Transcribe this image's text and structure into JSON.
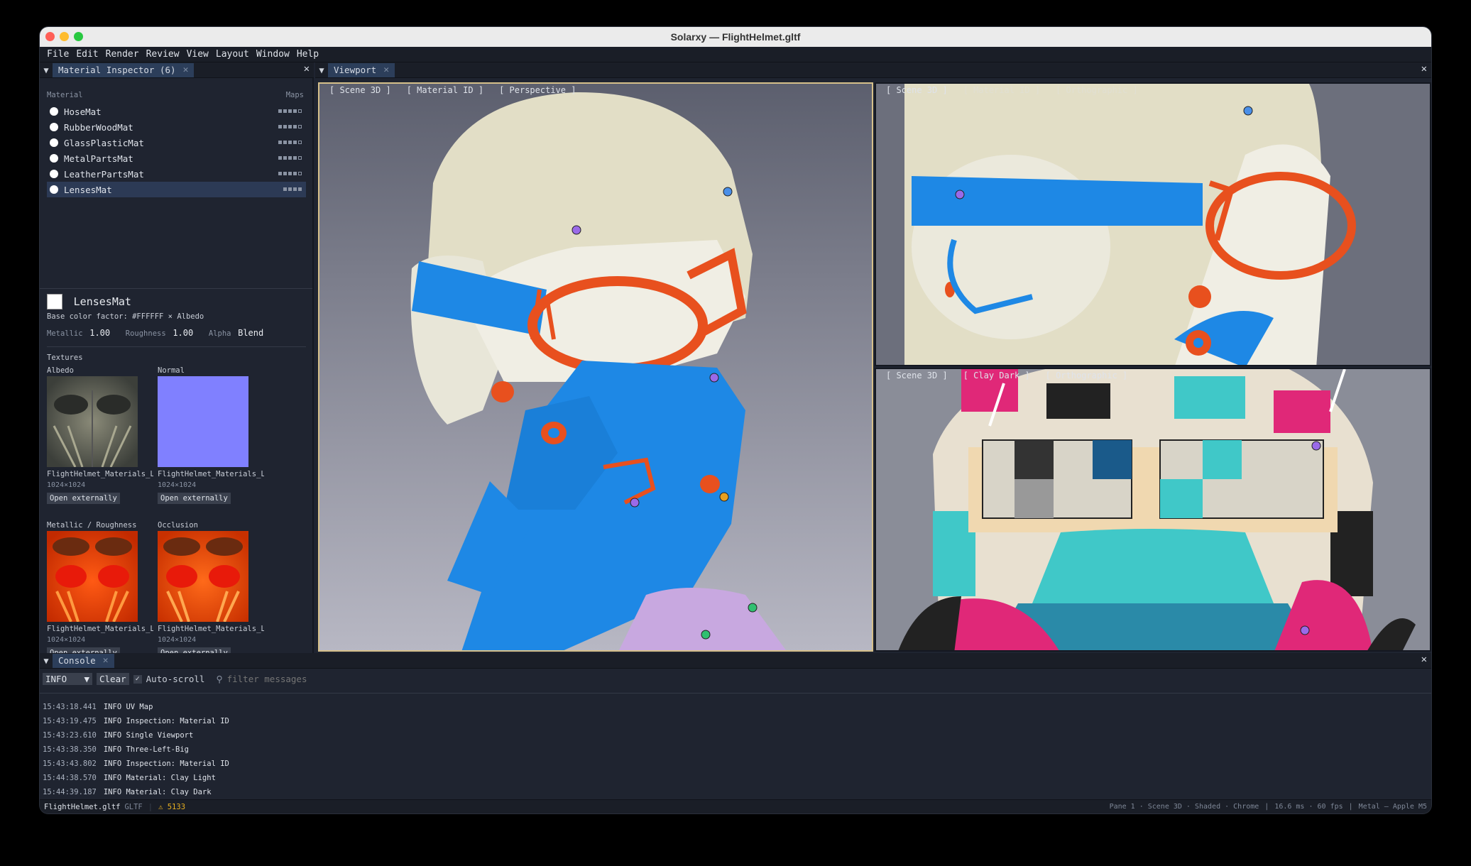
{
  "window": {
    "title": "Solarxy — FlightHelmet.gltf"
  },
  "menu": [
    "File",
    "Edit",
    "Render",
    "Review",
    "View",
    "Layout",
    "Window",
    "Help"
  ],
  "left_tab": {
    "label": "Material Inspector (6)",
    "close": "✕"
  },
  "viewport_tab": {
    "label": "Viewport",
    "close": "✕"
  },
  "console_tab": {
    "label": "Console",
    "close": "✕"
  },
  "material_list": {
    "col_material": "Material",
    "col_maps": "Maps",
    "items": [
      {
        "name": "HoseMat",
        "maps": [
          1,
          1,
          1,
          1,
          0
        ]
      },
      {
        "name": "RubberWoodMat",
        "maps": [
          1,
          1,
          1,
          1,
          0
        ]
      },
      {
        "name": "GlassPlasticMat",
        "maps": [
          1,
          1,
          1,
          1,
          0
        ]
      },
      {
        "name": "MetalPartsMat",
        "maps": [
          1,
          1,
          1,
          1,
          0
        ]
      },
      {
        "name": "LeatherPartsMat",
        "maps": [
          1,
          1,
          1,
          1,
          0
        ]
      },
      {
        "name": "LensesMat",
        "maps": [
          1,
          1,
          1,
          1
        ]
      }
    ],
    "selected": "LensesMat"
  },
  "detail": {
    "name": "LensesMat",
    "base_color": "Base color factor: #FFFFFF × Albedo",
    "metallic_label": "Metallic",
    "metallic": "1.00",
    "roughness_label": "Roughness",
    "roughness": "1.00",
    "alpha_label": "Alpha",
    "alpha": "Blend",
    "textures_label": "Textures",
    "textures": [
      {
        "slot": "Albedo",
        "file": "FlightHelmet_Materials_L…",
        "res": "1024×1024",
        "button": "Open externally"
      },
      {
        "slot": "Normal",
        "file": "FlightHelmet_Materials_L…",
        "res": "1024×1024",
        "button": "Open externally"
      },
      {
        "slot": "Metallic / Roughness",
        "file": "FlightHelmet_Materials_L…",
        "res": "1024×1024",
        "button": "Open externally"
      },
      {
        "slot": "Occlusion",
        "file": "FlightHelmet_Materials_L…",
        "res": "1024×1024",
        "button": "Open externally"
      }
    ]
  },
  "viewports": [
    {
      "labels": [
        "[ Scene 3D ]",
        "[ Material ID ]",
        "[ Perspective ]"
      ]
    },
    {
      "labels": [
        "[ Scene 3D ]",
        "[ Material ID ]",
        "[ Orthographic ]"
      ]
    },
    {
      "labels": [
        "[ Scene 3D ]",
        "[ Clay Dark ]",
        "[ Orthographic ]"
      ]
    }
  ],
  "console": {
    "level": "INFO",
    "clear": "Clear",
    "autoscroll": "Auto-scroll",
    "filter_placeholder": "filter messages",
    "lines": [
      {
        "ts": "15:43:18.441",
        "msg": "INFO UV Map"
      },
      {
        "ts": "15:43:19.475",
        "msg": "INFO Inspection: Material ID"
      },
      {
        "ts": "15:43:23.610",
        "msg": "INFO Single Viewport"
      },
      {
        "ts": "15:43:38.350",
        "msg": "INFO Three-Left-Big"
      },
      {
        "ts": "15:43:43.802",
        "msg": "INFO Inspection: Material ID"
      },
      {
        "ts": "15:44:38.570",
        "msg": "INFO Material: Clay Light"
      },
      {
        "ts": "15:44:39.187",
        "msg": "INFO Material: Clay Dark"
      }
    ]
  },
  "status": {
    "file": "FlightHelmet.gltf",
    "format": "GLTF",
    "warnings": "⚠ 5133",
    "pane": "Pane 1 · Scene 3D · Shaded · Chrome",
    "perf": "16.6 ms · 60 fps",
    "backend": "Metal — Apple M5"
  },
  "colors": {
    "accent": "#2c3e5a",
    "selected_row": "#2c3a55",
    "helmet_blue": "#1e88e5",
    "helmet_orange": "#e8501e",
    "helmet_cream": "#e4e0c8"
  }
}
